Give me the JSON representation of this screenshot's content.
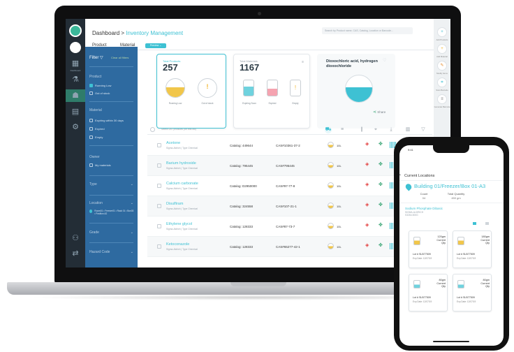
{
  "rail": {
    "labels": [
      "Dashboard",
      "Inventory",
      "Requests",
      "Lab Book",
      "Equipment",
      "Admin",
      "Switch Lab"
    ]
  },
  "header": {
    "crumb_root": "Dashboard >",
    "crumb_current": "Inventory Management",
    "search_placeholder": "Search by Product name, CAS, Catalog, Location or Barcode..."
  },
  "tabs": {
    "product": "Product",
    "material": "Material",
    "chip": "Preview ⌄"
  },
  "filter": {
    "title": "Filter ▽",
    "clear": "Clear all filters",
    "sec_product": "Product",
    "opt_running_low": "Running Low",
    "opt_out_of_stock": "Out of stock",
    "sec_material": "Material",
    "opt_expiring": "Expiring within 30 days",
    "opt_expired": "Expired",
    "opt_empty": "Empty",
    "sec_owner": "Owner",
    "opt_my_materials": "My materials",
    "sec_type": "Type",
    "sec_location": "Location",
    "location_value": "Room01 • Freezer01 • Rack 01 • Box03 • Position A2",
    "sec_grade": "Grade",
    "sec_hazard": "Hazard Code"
  },
  "cards": {
    "total_products_label": "Total Products",
    "total_products": "257",
    "running_low": "Running Low",
    "out_of_stock": "Out of stock",
    "total_materials_label": "Total Materials",
    "total_materials": "1167",
    "expiring_soon": "Expiring Soon",
    "expired": "Expired",
    "empty": "Empty",
    "dio_title": "Dioxochloric acid, hydrogen dioxochloride",
    "share": "Share"
  },
  "table": {
    "select_all": "Select 257 products (on this list)",
    "rows": [
      {
        "name": "Acetone",
        "sub": "Sigma-Aldrich | Type Chemical",
        "catalog": "Catalog: 449644",
        "cas": "CAS#10361-37-2",
        "qty": "10L"
      },
      {
        "name": "Barium hydroxide",
        "sub": "Sigma-Aldrich | Type Chemical",
        "catalog": "Catalog: 795445",
        "cas": "CAS#795445",
        "qty": "10L"
      },
      {
        "name": "Calcium carbonate",
        "sub": "Sigma-Aldrich | Type Chemical",
        "catalog": "Catalog: D2950000",
        "cas": "CAS#97-77-8",
        "qty": "10L"
      },
      {
        "name": "Disulfiram",
        "sub": "Sigma-Aldrich | Type Chemical",
        "catalog": "Catalog: 324558",
        "cas": "CAS#107-21-1",
        "qty": "10L"
      },
      {
        "name": "Ethylene glycol",
        "sub": "Sigma-Aldrich | Type Chemical",
        "catalog": "Catalog: 128333",
        "cas": "CAS#87-73-7",
        "qty": "10L"
      },
      {
        "name": "Ketoconazole",
        "sub": "Sigma-Aldrich | Type Chemical",
        "catalog": "Catalog: 128333",
        "cas": "CAS#65277-42-1",
        "qty": "10L"
      }
    ]
  },
  "right_rail": {
    "labels": [
      "Add Products",
      "Add Material",
      "Modify Items",
      "Scan Barcode",
      "Generate Barcode"
    ]
  },
  "phone": {
    "status": "9:41",
    "title": "Current Locations",
    "location": "Building 01/Freezer/Box 01-A3",
    "count_label": "Count",
    "count_value": "04",
    "qty_label": "Total Quantity",
    "qty_value": "450 gm",
    "product": "Sodium Phosphate Dibasic",
    "product_sub1": "SIGMA-ALDRICH",
    "product_sub2": "S3264-500G",
    "items": [
      {
        "qty": "120gm",
        "cur": "Current",
        "qty_lbl": "Qty",
        "lot": "Lot # SLB77509",
        "exp": "Exp Date: 12/07/19"
      },
      {
        "qty": "180gm",
        "cur": "Current",
        "qty_lbl": "Qty",
        "lot": "Lot # SLB77509",
        "exp": "Exp Date: 12/07/19"
      },
      {
        "qty": "80gm",
        "cur": "Current",
        "qty_lbl": "Qty",
        "lot": "Lot # SLB77509",
        "exp": "Exp Date: 12/07/19"
      },
      {
        "qty": "80gm",
        "cur": "Current",
        "qty_lbl": "Qty",
        "lot": "Lot # SLB77509",
        "exp": "Exp Date: 12/07/19"
      }
    ]
  }
}
